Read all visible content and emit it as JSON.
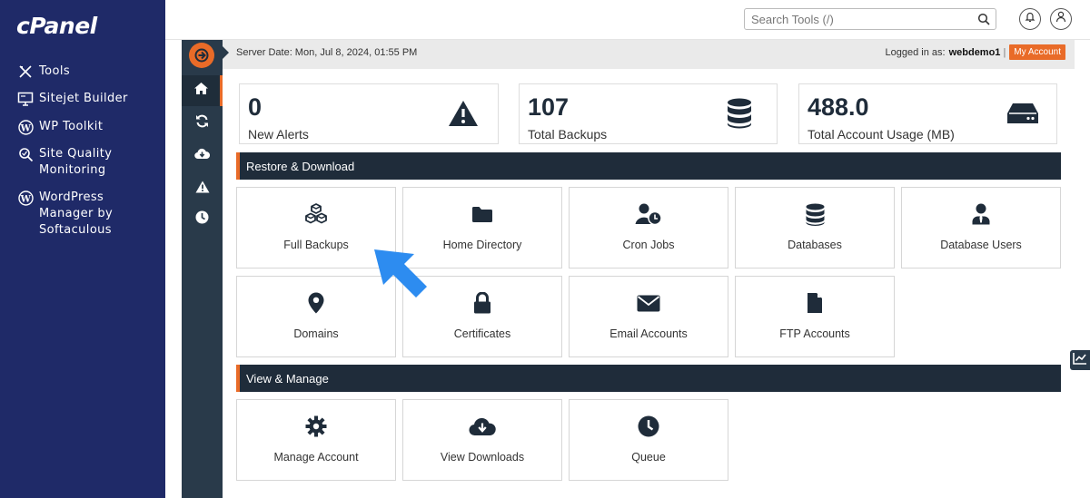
{
  "sidebar": {
    "logo": "cPanel",
    "items": [
      {
        "label": "Tools",
        "icon": "tools-icon"
      },
      {
        "label": "Sitejet Builder",
        "icon": "monitor-icon"
      },
      {
        "label": "WP Toolkit",
        "icon": "wordpress-icon"
      },
      {
        "label": "Site Quality Monitoring",
        "icon": "magnifier-icon"
      },
      {
        "label": "WordPress Manager by Softaculous",
        "icon": "wordpress-icon"
      }
    ]
  },
  "header": {
    "search_placeholder": "Search Tools (/)"
  },
  "infobar": {
    "server_date": "Server Date: Mon, Jul 8, 2024, 01:55 PM",
    "logged_in_label": "Logged in as:",
    "username": "webdemo1",
    "separator": "|",
    "my_account": "My Account"
  },
  "stats": [
    {
      "value": "0",
      "label": "New Alerts",
      "icon": "warning-icon"
    },
    {
      "value": "107",
      "label": "Total Backups",
      "icon": "database-icon"
    },
    {
      "value": "488.0",
      "label": "Total Account Usage (MB)",
      "icon": "hard-drive-icon"
    }
  ],
  "sections": {
    "restore": {
      "title": "Restore & Download",
      "tiles": [
        {
          "label": "Full Backups",
          "icon": "boxes-icon"
        },
        {
          "label": "Home Directory",
          "icon": "folder-icon"
        },
        {
          "label": "Cron Jobs",
          "icon": "user-clock-icon"
        },
        {
          "label": "Databases",
          "icon": "database-icon"
        },
        {
          "label": "Database Users",
          "icon": "user-tie-icon"
        },
        {
          "label": "Domains",
          "icon": "map-marker-icon"
        },
        {
          "label": "Certificates",
          "icon": "lock-icon"
        },
        {
          "label": "Email Accounts",
          "icon": "envelope-icon"
        },
        {
          "label": "FTP Accounts",
          "icon": "file-icon"
        }
      ]
    },
    "manage": {
      "title": "View & Manage",
      "tiles": [
        {
          "label": "Manage Account",
          "icon": "gear-icon"
        },
        {
          "label": "View Downloads",
          "icon": "cloud-download-icon"
        },
        {
          "label": "Queue",
          "icon": "clock-icon"
        }
      ]
    }
  },
  "colors": {
    "sidebar_bg": "#1f2a68",
    "rail_bg": "#293a4a",
    "accent": "#e96b28",
    "section_bg": "#1f2c3a",
    "pointer_arrow": "#2d8cf0"
  }
}
